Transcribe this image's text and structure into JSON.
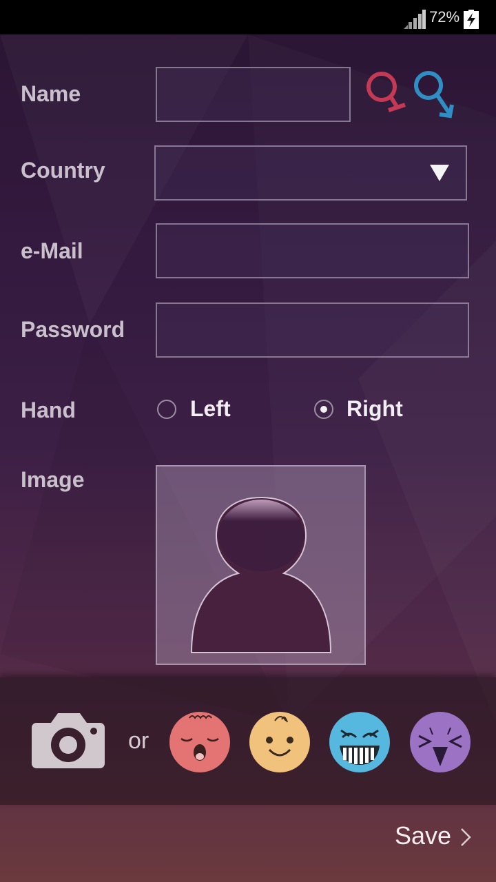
{
  "status": {
    "battery": "72%"
  },
  "form": {
    "name_label": "Name",
    "country_label": "Country",
    "email_label": "e-Mail",
    "password_label": "Password",
    "hand_label": "Hand",
    "image_label": "Image",
    "name_value": "",
    "email_value": "",
    "password_value": "",
    "country_value": "",
    "hand_options": [
      {
        "label": "Left",
        "selected": false
      },
      {
        "label": "Right",
        "selected": true
      }
    ]
  },
  "avatar_picker": {
    "or_label": "or",
    "faces": [
      "yawning-face-icon",
      "happy-face-icon",
      "grinning-face-icon",
      "laughing-face-icon"
    ],
    "face_colors": [
      "#e47373",
      "#f0c27b",
      "#56b8de",
      "#9b72c4"
    ]
  },
  "footer": {
    "save_label": "Save"
  },
  "colors": {
    "female": "#c43a55",
    "male": "#2f8ec4"
  }
}
